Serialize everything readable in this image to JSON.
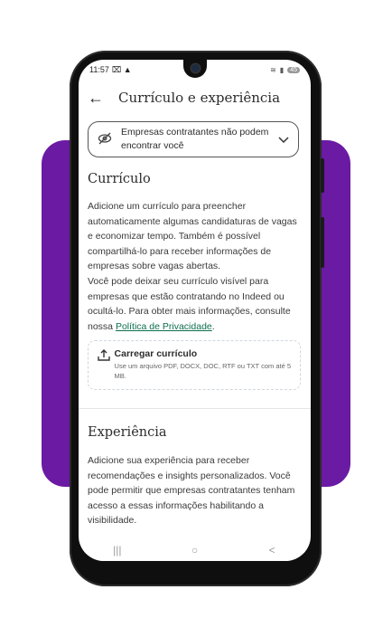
{
  "status": {
    "time": "11:57",
    "left_icons": "⌧ ▲",
    "battery": "45"
  },
  "header": {
    "back_icon": "back-arrow-icon",
    "title": "Currículo e experiência"
  },
  "privacy": {
    "text": "Empresas contratantes não podem encontrar você",
    "icon": "eye-slash-icon",
    "chevron": "chevron-down-icon"
  },
  "resume": {
    "title": "Currículo",
    "para1": "Adicione um currículo para preencher automaticamente algumas candidaturas de vagas e economizar tempo. Também é possível compartilhá-lo para receber informações de empresas sobre vagas abertas.",
    "para2": "Você pode deixar seu currículo visível para empresas que estão contratando no Indeed ou ocultá-lo. Para obter mais informações, consulte nossa ",
    "policy_link": "Política de Privacidade",
    "para2_end": ".",
    "upload_title": "Carregar currículo",
    "upload_hint": "Use um arquivo PDF, DOCX, DOC, RTF ou TXT com até 5 MB."
  },
  "experience": {
    "title": "Experiência",
    "para": "Adicione sua experiência para receber recomendações e insights personalizados. Você pode permitir que empresas contratantes tenham acesso a essas informações habilitando a visibilidade."
  },
  "nav": {
    "recent": "|||",
    "home": "○",
    "back": "<"
  },
  "colors": {
    "brand_purple": "#6b1aa3",
    "link_green": "#0b6e4f"
  }
}
